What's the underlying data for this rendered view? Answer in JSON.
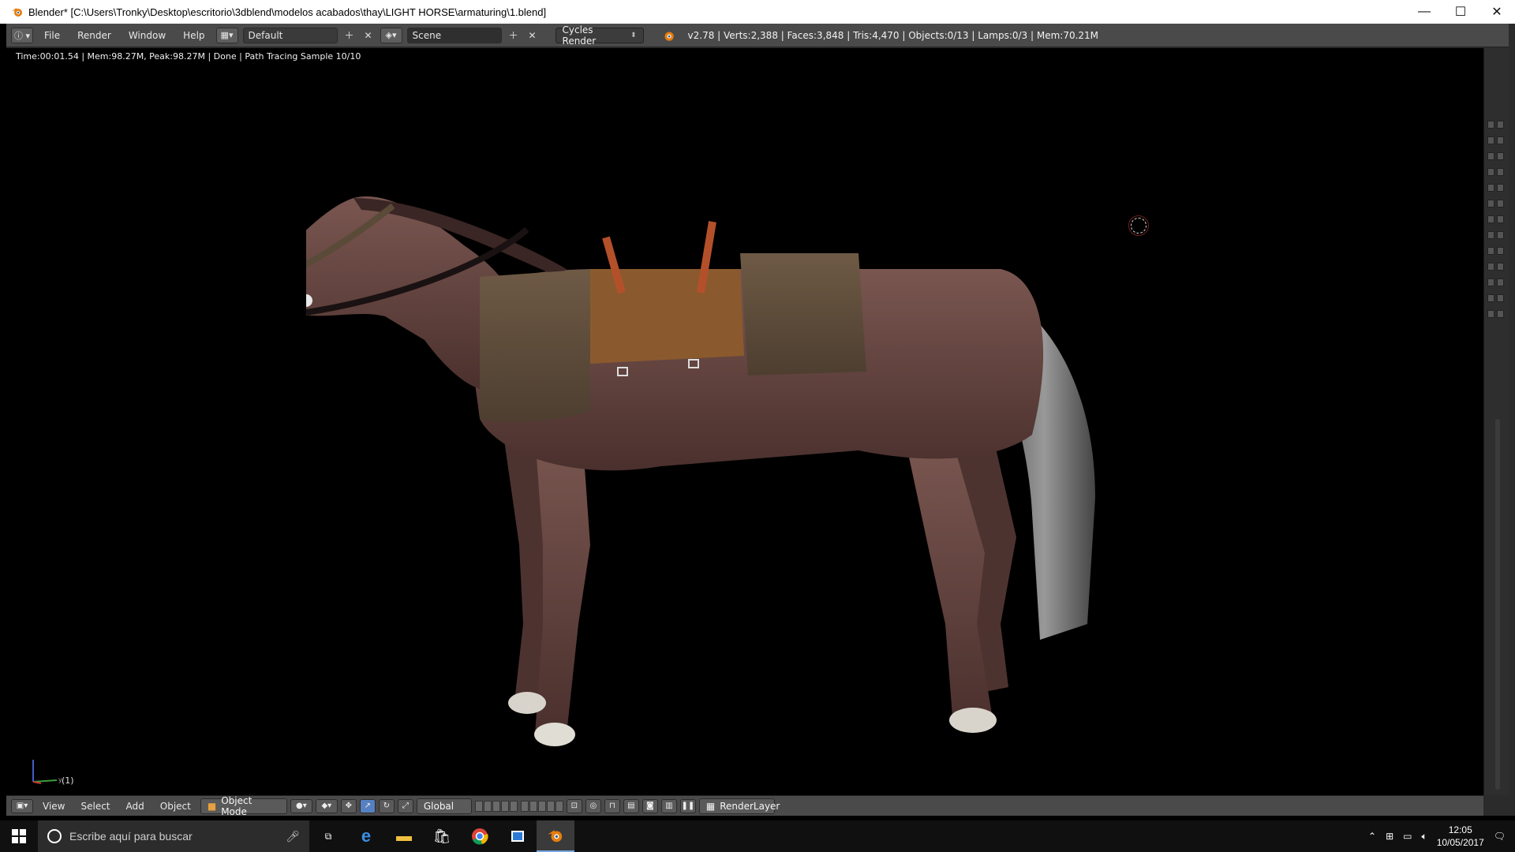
{
  "window": {
    "title": "Blender* [C:\\Users\\Tronky\\Desktop\\escritorio\\3dblend\\modelos acabados\\thay\\LIGHT HORSE\\armaturing\\1.blend]",
    "controls": {
      "minimize": "—",
      "maximize": "☐",
      "close": "✕"
    }
  },
  "info_header": {
    "menus": [
      "File",
      "Render",
      "Window",
      "Help"
    ],
    "screen_layout": "Default",
    "scene": "Scene",
    "render_engine": "Cycles Render",
    "stats": "v2.78 | Verts:2,388 | Faces:3,848 | Tris:4,470 | Objects:0/13 | Lamps:0/3 | Mem:70.21M"
  },
  "viewport": {
    "render_status": "Time:00:01.54 | Mem:98.27M, Peak:98.27M | Done | Path Tracing Sample 10/10",
    "frame_label": "(1)"
  },
  "view3d_header": {
    "menus": [
      "View",
      "Select",
      "Add",
      "Object"
    ],
    "mode": "Object Mode",
    "orientation": "Global",
    "render_layer": "RenderLayer"
  },
  "taskbar": {
    "search_placeholder": "Escribe aquí para buscar",
    "time": "12:05",
    "date": "10/05/2017"
  },
  "colors": {
    "blender_header": "#4a4a4a",
    "active_button": "#5680c2",
    "taskbar": "#101010"
  }
}
